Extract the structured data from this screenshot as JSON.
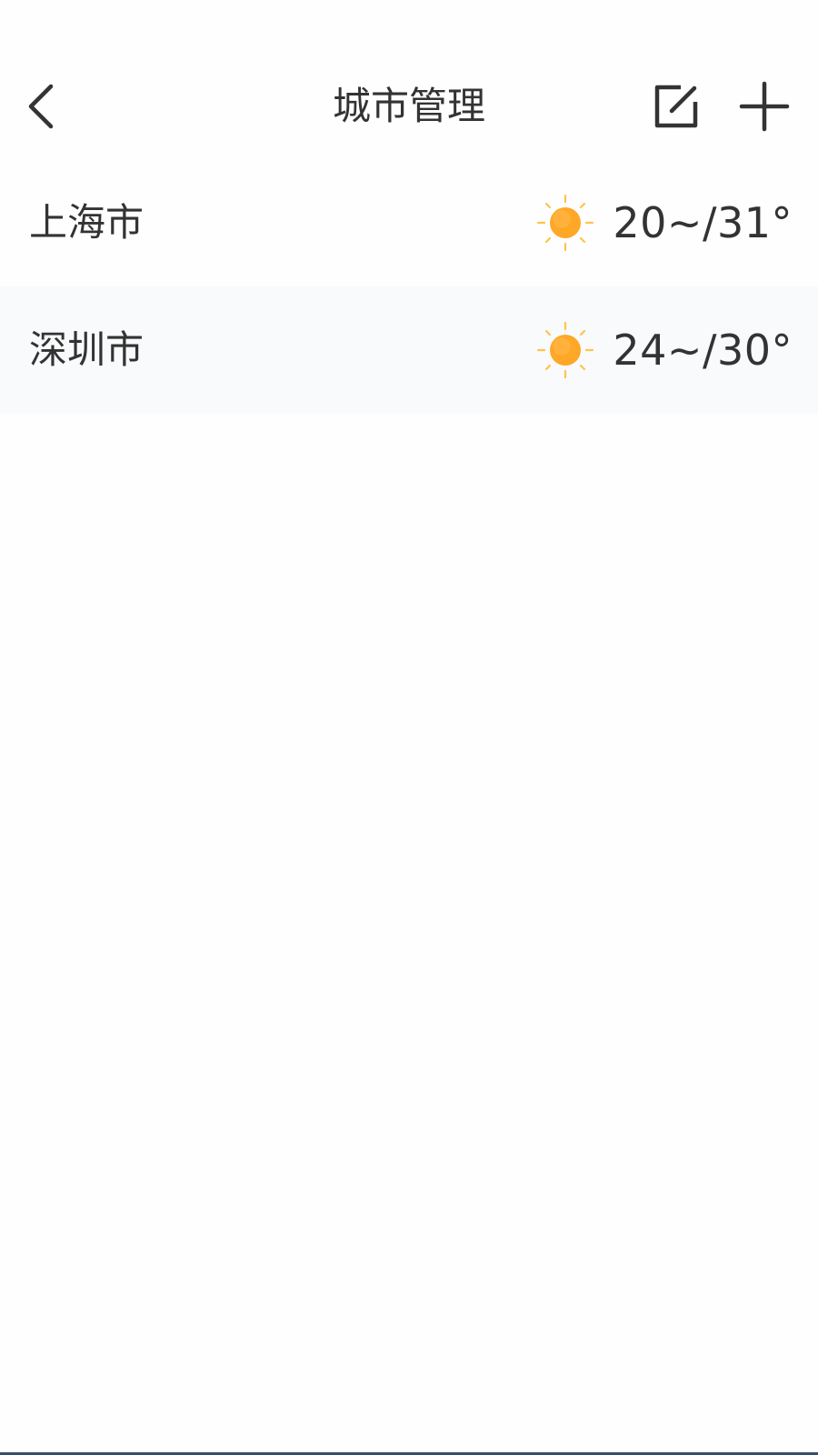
{
  "header": {
    "title": "城市管理",
    "back_icon": "chevron-left-icon",
    "edit_icon": "edit-square-icon",
    "add_icon": "plus-icon"
  },
  "cities": [
    {
      "name": "上海市",
      "weather_icon": "sunny-icon",
      "temp_range": "20~/31°"
    },
    {
      "name": "深圳市",
      "weather_icon": "sunny-icon",
      "temp_range": "24~/30°"
    }
  ],
  "colors": {
    "sun_core": "#FFA726",
    "sun_rays": "#FFC34D",
    "text": "#333333",
    "row_alt_bg": "#F8FAFB"
  }
}
